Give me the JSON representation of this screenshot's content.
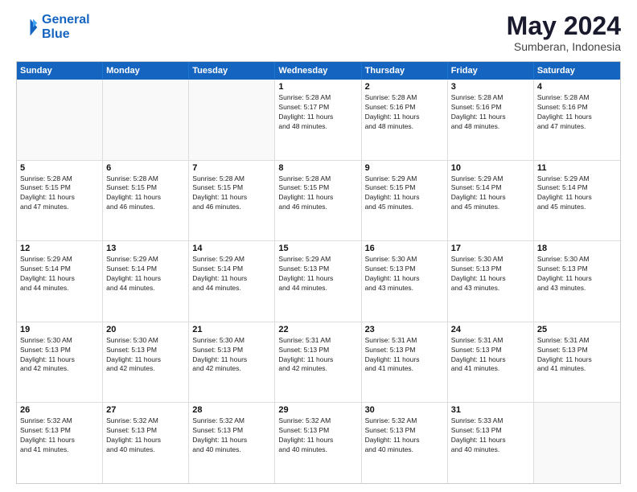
{
  "logo": {
    "line1": "General",
    "line2": "Blue"
  },
  "title": "May 2024",
  "subtitle": "Sumberan, Indonesia",
  "days_of_week": [
    "Sunday",
    "Monday",
    "Tuesday",
    "Wednesday",
    "Thursday",
    "Friday",
    "Saturday"
  ],
  "weeks": [
    [
      {
        "day": "",
        "info": ""
      },
      {
        "day": "",
        "info": ""
      },
      {
        "day": "",
        "info": ""
      },
      {
        "day": "1",
        "info": "Sunrise: 5:28 AM\nSunset: 5:17 PM\nDaylight: 11 hours\nand 48 minutes."
      },
      {
        "day": "2",
        "info": "Sunrise: 5:28 AM\nSunset: 5:16 PM\nDaylight: 11 hours\nand 48 minutes."
      },
      {
        "day": "3",
        "info": "Sunrise: 5:28 AM\nSunset: 5:16 PM\nDaylight: 11 hours\nand 48 minutes."
      },
      {
        "day": "4",
        "info": "Sunrise: 5:28 AM\nSunset: 5:16 PM\nDaylight: 11 hours\nand 47 minutes."
      }
    ],
    [
      {
        "day": "5",
        "info": "Sunrise: 5:28 AM\nSunset: 5:15 PM\nDaylight: 11 hours\nand 47 minutes."
      },
      {
        "day": "6",
        "info": "Sunrise: 5:28 AM\nSunset: 5:15 PM\nDaylight: 11 hours\nand 46 minutes."
      },
      {
        "day": "7",
        "info": "Sunrise: 5:28 AM\nSunset: 5:15 PM\nDaylight: 11 hours\nand 46 minutes."
      },
      {
        "day": "8",
        "info": "Sunrise: 5:28 AM\nSunset: 5:15 PM\nDaylight: 11 hours\nand 46 minutes."
      },
      {
        "day": "9",
        "info": "Sunrise: 5:29 AM\nSunset: 5:15 PM\nDaylight: 11 hours\nand 45 minutes."
      },
      {
        "day": "10",
        "info": "Sunrise: 5:29 AM\nSunset: 5:14 PM\nDaylight: 11 hours\nand 45 minutes."
      },
      {
        "day": "11",
        "info": "Sunrise: 5:29 AM\nSunset: 5:14 PM\nDaylight: 11 hours\nand 45 minutes."
      }
    ],
    [
      {
        "day": "12",
        "info": "Sunrise: 5:29 AM\nSunset: 5:14 PM\nDaylight: 11 hours\nand 44 minutes."
      },
      {
        "day": "13",
        "info": "Sunrise: 5:29 AM\nSunset: 5:14 PM\nDaylight: 11 hours\nand 44 minutes."
      },
      {
        "day": "14",
        "info": "Sunrise: 5:29 AM\nSunset: 5:14 PM\nDaylight: 11 hours\nand 44 minutes."
      },
      {
        "day": "15",
        "info": "Sunrise: 5:29 AM\nSunset: 5:13 PM\nDaylight: 11 hours\nand 44 minutes."
      },
      {
        "day": "16",
        "info": "Sunrise: 5:30 AM\nSunset: 5:13 PM\nDaylight: 11 hours\nand 43 minutes."
      },
      {
        "day": "17",
        "info": "Sunrise: 5:30 AM\nSunset: 5:13 PM\nDaylight: 11 hours\nand 43 minutes."
      },
      {
        "day": "18",
        "info": "Sunrise: 5:30 AM\nSunset: 5:13 PM\nDaylight: 11 hours\nand 43 minutes."
      }
    ],
    [
      {
        "day": "19",
        "info": "Sunrise: 5:30 AM\nSunset: 5:13 PM\nDaylight: 11 hours\nand 42 minutes."
      },
      {
        "day": "20",
        "info": "Sunrise: 5:30 AM\nSunset: 5:13 PM\nDaylight: 11 hours\nand 42 minutes."
      },
      {
        "day": "21",
        "info": "Sunrise: 5:30 AM\nSunset: 5:13 PM\nDaylight: 11 hours\nand 42 minutes."
      },
      {
        "day": "22",
        "info": "Sunrise: 5:31 AM\nSunset: 5:13 PM\nDaylight: 11 hours\nand 42 minutes."
      },
      {
        "day": "23",
        "info": "Sunrise: 5:31 AM\nSunset: 5:13 PM\nDaylight: 11 hours\nand 41 minutes."
      },
      {
        "day": "24",
        "info": "Sunrise: 5:31 AM\nSunset: 5:13 PM\nDaylight: 11 hours\nand 41 minutes."
      },
      {
        "day": "25",
        "info": "Sunrise: 5:31 AM\nSunset: 5:13 PM\nDaylight: 11 hours\nand 41 minutes."
      }
    ],
    [
      {
        "day": "26",
        "info": "Sunrise: 5:32 AM\nSunset: 5:13 PM\nDaylight: 11 hours\nand 41 minutes."
      },
      {
        "day": "27",
        "info": "Sunrise: 5:32 AM\nSunset: 5:13 PM\nDaylight: 11 hours\nand 40 minutes."
      },
      {
        "day": "28",
        "info": "Sunrise: 5:32 AM\nSunset: 5:13 PM\nDaylight: 11 hours\nand 40 minutes."
      },
      {
        "day": "29",
        "info": "Sunrise: 5:32 AM\nSunset: 5:13 PM\nDaylight: 11 hours\nand 40 minutes."
      },
      {
        "day": "30",
        "info": "Sunrise: 5:32 AM\nSunset: 5:13 PM\nDaylight: 11 hours\nand 40 minutes."
      },
      {
        "day": "31",
        "info": "Sunrise: 5:33 AM\nSunset: 5:13 PM\nDaylight: 11 hours\nand 40 minutes."
      },
      {
        "day": "",
        "info": ""
      }
    ]
  ]
}
